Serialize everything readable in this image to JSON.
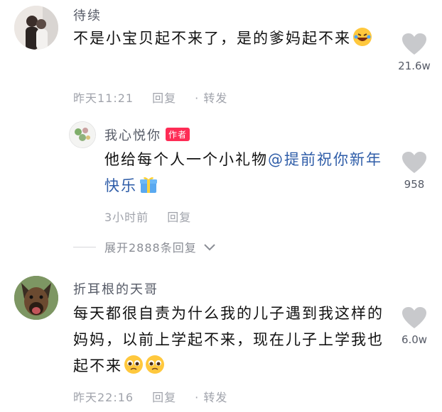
{
  "comments": [
    {
      "username": "待续",
      "text": "不是小宝贝起不来了，是的爹妈起不来",
      "time": "昨天11:21",
      "reply_label": "回复",
      "forward_label": "· 转发",
      "likes": "21.6w"
    },
    {
      "username": "我心悦你",
      "badge": "作者",
      "text": "他给每个人一个小礼物",
      "mention": "@提前祝你新年快乐",
      "time": "3小时前",
      "reply_label": "回复",
      "likes": "958"
    },
    {
      "username": "折耳根的天哥",
      "text": "每天都很自责为什么我的儿子遇到我这样的妈妈，以前上学起不来，现在儿子上学我也起不来",
      "time": "昨天22:16",
      "reply_label": "回复",
      "forward_label": "· 转发",
      "likes": "6.0w"
    }
  ],
  "expand_replies": "展开2888条回复",
  "colors": {
    "like_heart": "#c8c9cc",
    "badge": "#fe2c55",
    "mention": "#2f5da8"
  }
}
